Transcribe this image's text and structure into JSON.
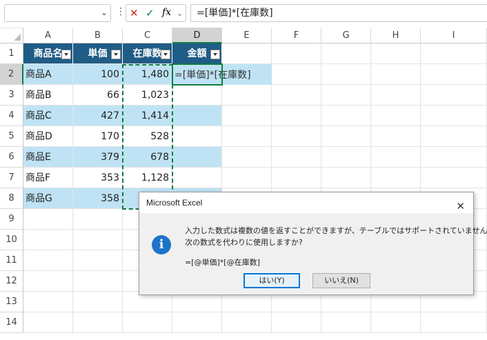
{
  "formula_bar": {
    "name_box_value": "",
    "cancel_icon": "x-icon",
    "enter_icon": "checkmark-icon",
    "fx_label": "fx",
    "formula": "=[単価]*[在庫数]"
  },
  "columns": [
    "A",
    "B",
    "C",
    "D",
    "E",
    "F",
    "G",
    "H",
    "I"
  ],
  "rows": [
    "1",
    "2",
    "3",
    "4",
    "5",
    "6",
    "7",
    "8",
    "9",
    "10",
    "11",
    "12",
    "13",
    "14"
  ],
  "table": {
    "headers": [
      "商品名",
      "単価",
      "在庫数",
      "金額"
    ],
    "data": [
      {
        "name": "商品A",
        "price": "100",
        "stock": "1,480"
      },
      {
        "name": "商品B",
        "price": "66",
        "stock": "1,023"
      },
      {
        "name": "商品C",
        "price": "427",
        "stock": "1,414"
      },
      {
        "name": "商品D",
        "price": "170",
        "stock": "528"
      },
      {
        "name": "商品E",
        "price": "379",
        "stock": "678"
      },
      {
        "name": "商品F",
        "price": "353",
        "stock": "1,128"
      },
      {
        "name": "商品G",
        "price": "358",
        "stock": ""
      }
    ],
    "editing_formula": "=[単価]*[在庫数]"
  },
  "dialog": {
    "title": "Microsoft Excel",
    "close": "✕",
    "icon": "information-icon",
    "icon_glyph": "i",
    "line1": "入力した数式は複数の値を返すことができますが、テーブルではサポートされていません。",
    "line2": "次の数式を代わりに使用しますか?",
    "line3": "=[@単価]*[@在庫数]",
    "yes": "はい(Y)",
    "no": "いいえ(N)"
  },
  "colors": {
    "header_bg": "#1f5c86",
    "band_bg": "#bfe3f4",
    "accent": "#107c41"
  }
}
